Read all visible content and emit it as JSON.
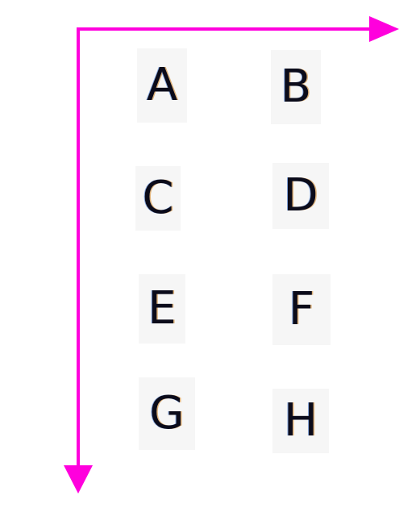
{
  "arrow_color": "#ff00dd",
  "grid": {
    "rows": [
      [
        "A",
        "B"
      ],
      [
        "C",
        "D"
      ],
      [
        "E",
        "F"
      ],
      [
        "G",
        "H"
      ]
    ]
  }
}
